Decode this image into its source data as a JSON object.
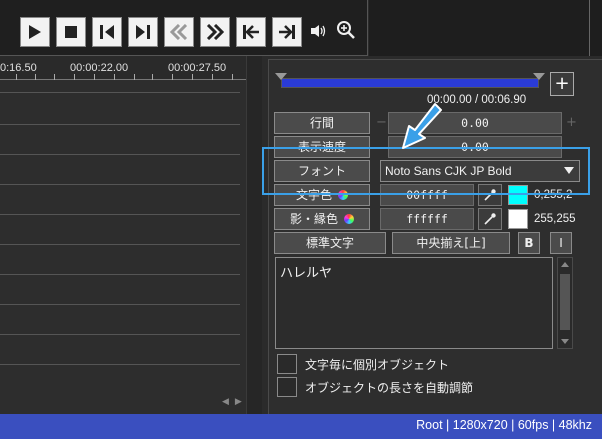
{
  "colors": {
    "accent": "#3aa0e8",
    "status_bar": "#3a4fbf",
    "mini_bar": "#2a3bd6",
    "cyan_swatch": "#00ffff",
    "white_swatch": "#ffffff"
  },
  "transport": {
    "buttons": [
      "play-icon",
      "stop-icon",
      "prev-frame-icon",
      "next-frame-icon",
      "rewind-icon",
      "fast-forward-icon",
      "go-to-start-icon",
      "go-to-end-icon"
    ],
    "volume_icon": "volume-icon",
    "zoom_icon": "zoom-icon"
  },
  "timeline": {
    "ruler_labels": [
      "0:16.50",
      "00:00:22.00",
      "00:00:27.50"
    ]
  },
  "panel": {
    "add_label": "+",
    "time_readout": "00:00.00 / 00:06.90",
    "line_spacing": {
      "label": "行間",
      "value": "0.00",
      "minus": "−",
      "plus": "+"
    },
    "display_speed": {
      "label": "表示速度",
      "value": "0.00"
    },
    "font": {
      "label": "フォント",
      "value": "Noto Sans CJK JP Bold"
    },
    "text_color": {
      "label": "文字色",
      "value": "00ffff",
      "rgb": "0,255,2"
    },
    "shadow_color": {
      "label": "影・縁色",
      "value": "ffffff",
      "rgb": "255,255"
    },
    "standard_text_label": "標準文字",
    "align_label": "中央揃え[上]",
    "bold_label": "B",
    "italic_label": "I",
    "text_content": "ハレルヤ",
    "check_individual": "文字毎に個別オブジェクト",
    "check_auto_length": "オブジェクトの長さを自動調節"
  },
  "status": {
    "text": "Root  |  1280x720  |  60fps  |  48khz"
  }
}
